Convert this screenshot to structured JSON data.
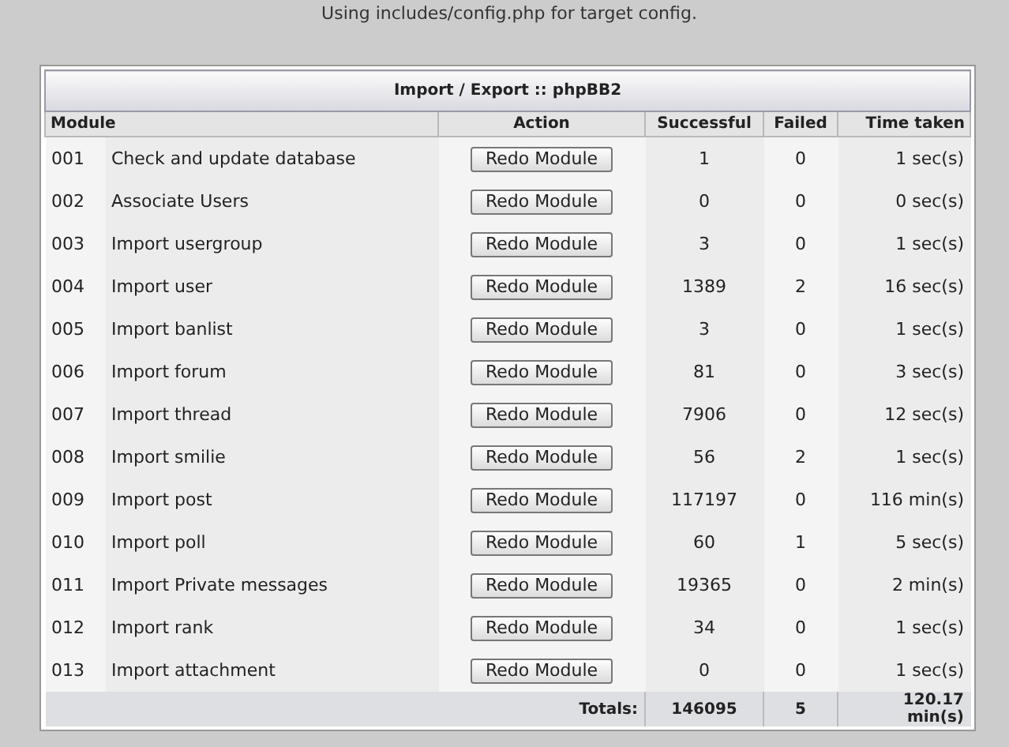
{
  "notice": "Using includes/config.php for target config.",
  "table": {
    "title": "Import / Export :: phpBB2",
    "columns": [
      "Module",
      "Action",
      "Successful",
      "Failed",
      "Time taken"
    ],
    "rows": [
      {
        "number": "001",
        "name": "Check and update database",
        "action": "Redo Module",
        "successful": "1",
        "failed": "0",
        "time": "1 sec(s)"
      },
      {
        "number": "002",
        "name": "Associate Users",
        "action": "Redo Module",
        "successful": "0",
        "failed": "0",
        "time": "0 sec(s)"
      },
      {
        "number": "003",
        "name": "Import usergroup",
        "action": "Redo Module",
        "successful": "3",
        "failed": "0",
        "time": "1 sec(s)"
      },
      {
        "number": "004",
        "name": "Import user",
        "action": "Redo Module",
        "successful": "1389",
        "failed": "2",
        "time": "16 sec(s)"
      },
      {
        "number": "005",
        "name": "Import banlist",
        "action": "Redo Module",
        "successful": "3",
        "failed": "0",
        "time": "1 sec(s)"
      },
      {
        "number": "006",
        "name": "Import forum",
        "action": "Redo Module",
        "successful": "81",
        "failed": "0",
        "time": "3 sec(s)"
      },
      {
        "number": "007",
        "name": "Import thread",
        "action": "Redo Module",
        "successful": "7906",
        "failed": "0",
        "time": "12 sec(s)"
      },
      {
        "number": "008",
        "name": "Import smilie",
        "action": "Redo Module",
        "successful": "56",
        "failed": "2",
        "time": "1 sec(s)"
      },
      {
        "number": "009",
        "name": "Import post",
        "action": "Redo Module",
        "successful": "117197",
        "failed": "0",
        "time": "116 min(s)"
      },
      {
        "number": "010",
        "name": "Import poll",
        "action": "Redo Module",
        "successful": "60",
        "failed": "1",
        "time": "5 sec(s)"
      },
      {
        "number": "011",
        "name": "Import Private messages",
        "action": "Redo Module",
        "successful": "19365",
        "failed": "0",
        "time": "2 min(s)"
      },
      {
        "number": "012",
        "name": "Import rank",
        "action": "Redo Module",
        "successful": "34",
        "failed": "0",
        "time": "1 sec(s)"
      },
      {
        "number": "013",
        "name": "Import attachment",
        "action": "Redo Module",
        "successful": "0",
        "failed": "0",
        "time": "1 sec(s)"
      }
    ],
    "totals": {
      "label": "Totals:",
      "successful": "146095",
      "failed": "5",
      "time": "120.17 min(s)"
    }
  }
}
